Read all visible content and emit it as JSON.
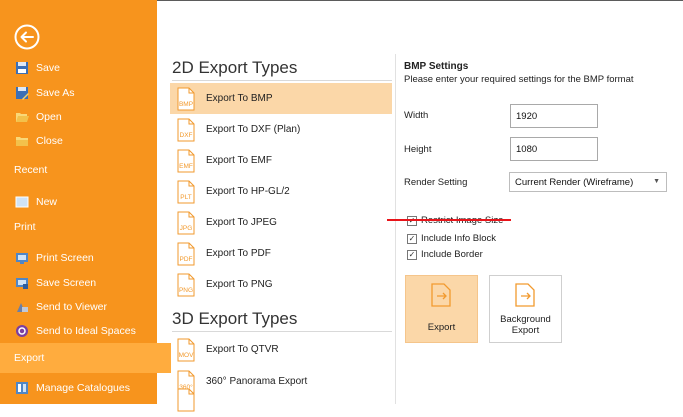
{
  "sidebar": {
    "items": [
      {
        "label": "Save",
        "icon": "save-icon"
      },
      {
        "label": "Save As",
        "icon": "save-as-icon"
      },
      {
        "label": "Open",
        "icon": "folder-open-icon"
      },
      {
        "label": "Close",
        "icon": "folder-close-icon"
      }
    ],
    "recent": "Recent",
    "new_label": "New",
    "print": "Print",
    "print_screen": "Print Screen",
    "save_screen": "Save Screen",
    "send_to_viewer": "Send to Viewer",
    "send_to_ideal": "Send to Ideal Spaces",
    "export": "Export",
    "manage_catalogues": "Manage Catalogues"
  },
  "export_2d": {
    "title": "2D Export Types",
    "items": [
      {
        "tag": "BMP",
        "label": "Export To BMP"
      },
      {
        "tag": "DXF",
        "label": "Export To DXF (Plan)"
      },
      {
        "tag": "EMF",
        "label": "Export To EMF"
      },
      {
        "tag": "PLT",
        "label": "Export To HP-GL/2"
      },
      {
        "tag": "JPG",
        "label": "Export To JPEG"
      },
      {
        "tag": "PDF",
        "label": "Export To PDF"
      },
      {
        "tag": "PNG",
        "label": "Export To PNG"
      }
    ]
  },
  "export_3d": {
    "title": "3D Export Types",
    "items": [
      {
        "tag": "MOV",
        "label": "Export To QTVR"
      },
      {
        "tag": "360°",
        "label": "360° Panorama Export"
      }
    ]
  },
  "settings": {
    "title": "BMP Settings",
    "subtitle": "Please enter your required settings for the BMP format",
    "width_label": "Width",
    "width_value": "1920",
    "height_label": "Height",
    "height_value": "1080",
    "render_label": "Render Setting",
    "render_value": "Current Render (Wireframe)",
    "checks": [
      {
        "label": "Restrict Image Size",
        "checked": true
      },
      {
        "label": "Include Info Block",
        "checked": true
      },
      {
        "label": "Include Border",
        "checked": true
      }
    ],
    "export_button": "Export",
    "background_export_line1": "Background",
    "background_export_line2": "Export"
  },
  "colors": {
    "sidebar": "#f7941d",
    "sidebar_active": "#ffac3e",
    "selected_item": "#fbd7a8",
    "doc_icon": "#f29a2e",
    "annotation_line": "#e8141a"
  }
}
